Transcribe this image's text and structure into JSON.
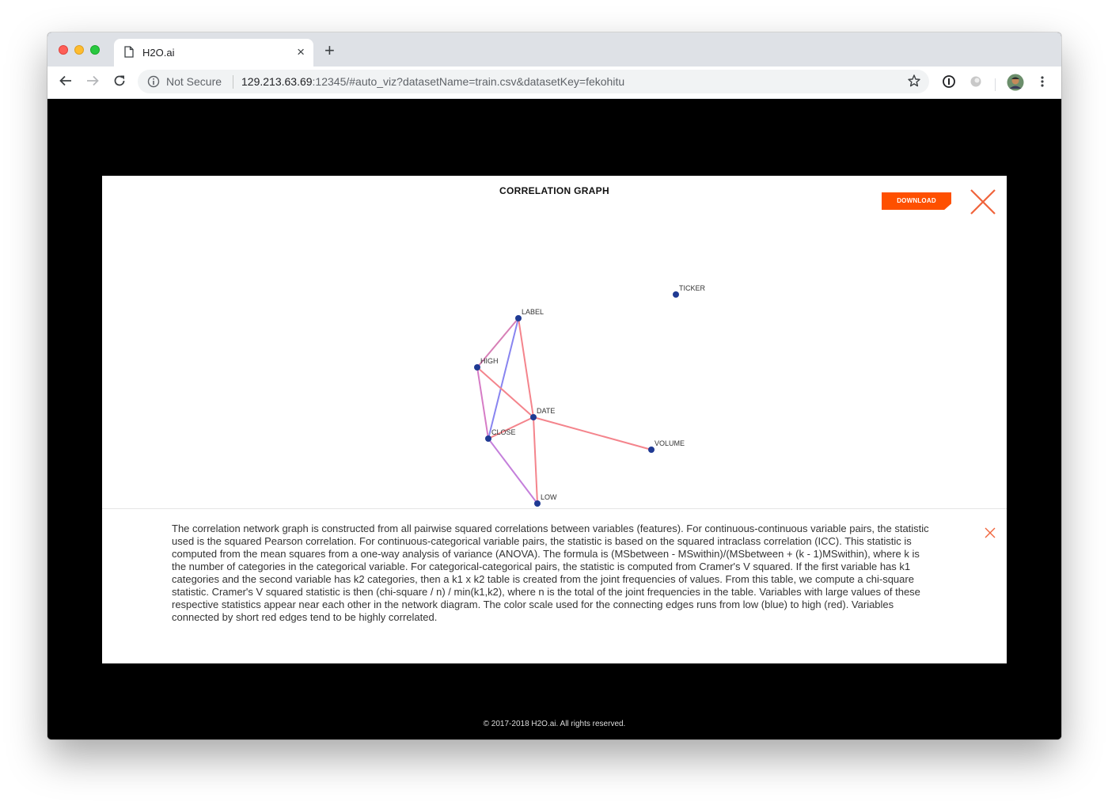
{
  "browser": {
    "tab_title": "H2O.ai",
    "security_label": "Not Secure",
    "url_host": "129.213.63.69",
    "url_rest": ":12345/#auto_viz?datasetName=train.csv&datasetKey=fekohitu"
  },
  "modal": {
    "title": "CORRELATION GRAPH",
    "download_label": "DOWNLOAD",
    "description": "The correlation network graph is constructed from all pairwise squared correlations between variables (features). For continuous-continuous variable pairs, the statistic used is the squared Pearson correlation. For continuous-categorical variable pairs, the statistic is based on the squared intraclass correlation (ICC). This statistic is computed from the mean squares from a one-way analysis of variance (ANOVA). The formula is (MSbetween - MSwithin)/(MSbetween + (k - 1)MSwithin), where k is the number of categories in the categorical variable. For categorical-categorical pairs, the statistic is computed from Cramer's V squared. If the first variable has k1 categories and the second variable has k2 categories, then a k1 x k2 table is created from the joint frequencies of values. From this table, we compute a chi-square statistic. Cramer's V squared statistic is then (chi-square / n) / min(k1,k2), where n is the total of the joint frequencies in the table. Variables with large values of these respective statistics appear near each other in the network diagram. The color scale used for the connecting edges runs from low (blue) to high (red). Variables connected by short red edges tend to be highly correlated."
  },
  "graph": {
    "node_color": "#1f3a93",
    "nodes": [
      "TICKER",
      "LABEL",
      "HIGH",
      "DATE",
      "CLOSE",
      "VOLUME",
      "LOW"
    ],
    "edges": [
      {
        "from": "LABEL",
        "to": "HIGH",
        "color": "#d77fb6"
      },
      {
        "from": "LABEL",
        "to": "CLOSE",
        "color": "#8884f0"
      },
      {
        "from": "LABEL",
        "to": "DATE",
        "color": "#f4848c"
      },
      {
        "from": "HIGH",
        "to": "DATE",
        "color": "#f4848c"
      },
      {
        "from": "HIGH",
        "to": "CLOSE",
        "color": "#d67cc6"
      },
      {
        "from": "CLOSE",
        "to": "DATE",
        "color": "#f4848c"
      },
      {
        "from": "DATE",
        "to": "VOLUME",
        "color": "#f4848c"
      },
      {
        "from": "DATE",
        "to": "LOW",
        "color": "#f4848c"
      },
      {
        "from": "CLOSE",
        "to": "LOW",
        "color": "#c47fdb"
      }
    ]
  },
  "footer": {
    "text": "© 2017-2018 H2O.ai. All rights reserved."
  },
  "colors": {
    "accent": "#fe5000",
    "window_background": "#000000"
  }
}
